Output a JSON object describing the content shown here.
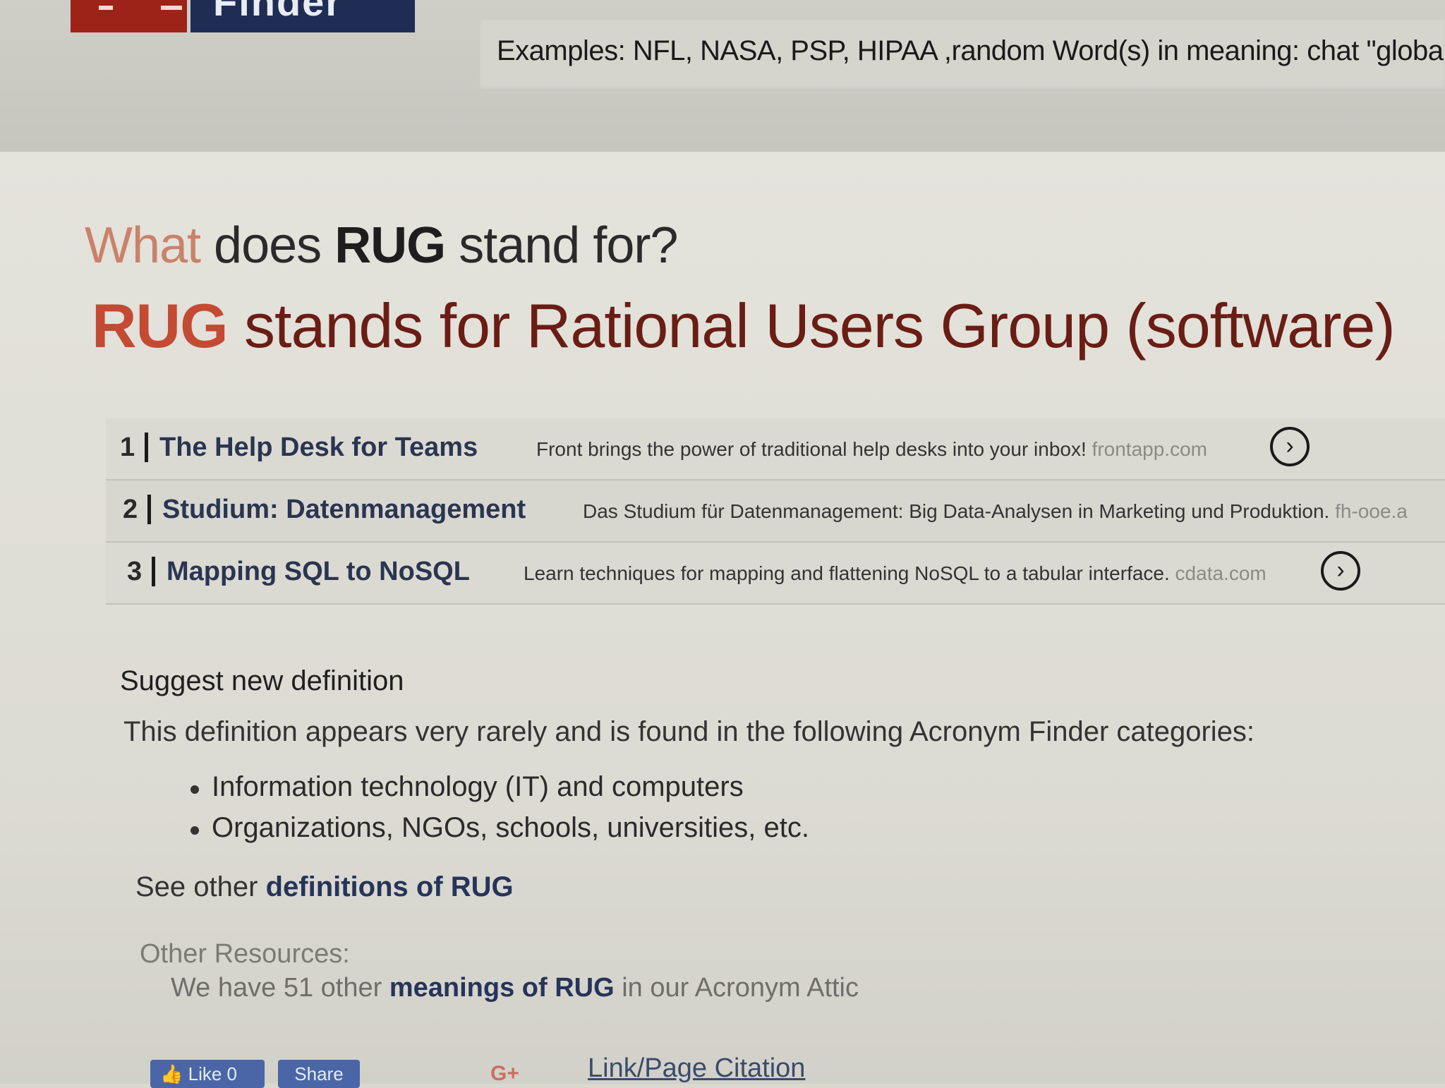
{
  "header": {
    "logo_text": "Finder",
    "examples_text": "Examples: NFL, NASA, PSP, HIPAA ,random Word(s) in meaning: chat  \"global wa"
  },
  "question": {
    "lead": "What",
    "pre": " does ",
    "acronym": "RUG",
    "post": " stand for?"
  },
  "answer": {
    "acronym": "RUG",
    "text": " stands for Rational Users Group (software)"
  },
  "ads": [
    {
      "num": "1",
      "title": "The Help Desk for Teams",
      "desc": "Front brings the power of traditional help desks into your inbox!",
      "domain": " frontapp.com",
      "arrow": "›"
    },
    {
      "num": "2",
      "title": "Studium: Datenmanagement",
      "desc": "Das Studium für Datenmanagement: Big Data-Analysen in Marketing und Produktion.",
      "domain": " fh-ooe.a"
    },
    {
      "num": "3",
      "title": "Mapping SQL to NoSQL",
      "desc": "Learn techniques for mapping and flattening NoSQL to a tabular interface.",
      "domain": " cdata.com",
      "arrow": "›"
    }
  ],
  "suggest_label": "Suggest new definition",
  "appears_text": "This definition appears very rarely and is found in the following Acronym Finder categories:",
  "categories": [
    "Information technology (IT) and computers",
    "Organizations, NGOs, schools, universities, etc."
  ],
  "see_other": {
    "pre": "See other ",
    "link": "definitions of RUG"
  },
  "other_resources": {
    "label": "Other Resources:",
    "pre": "We have 51 other ",
    "link": "meanings of RUG",
    "post": " in our Acronym Attic"
  },
  "social": {
    "like_label": "Like 0",
    "share_label": "Share",
    "gplus_label": "G+",
    "citation_label": "Link/Page Citation"
  },
  "colors": {
    "brand_red": "#9d2318",
    "brand_navy": "#1f2d55",
    "answer_red": "#6a1d14",
    "link_navy": "#26345a",
    "facebook_blue": "#4a66a6"
  }
}
